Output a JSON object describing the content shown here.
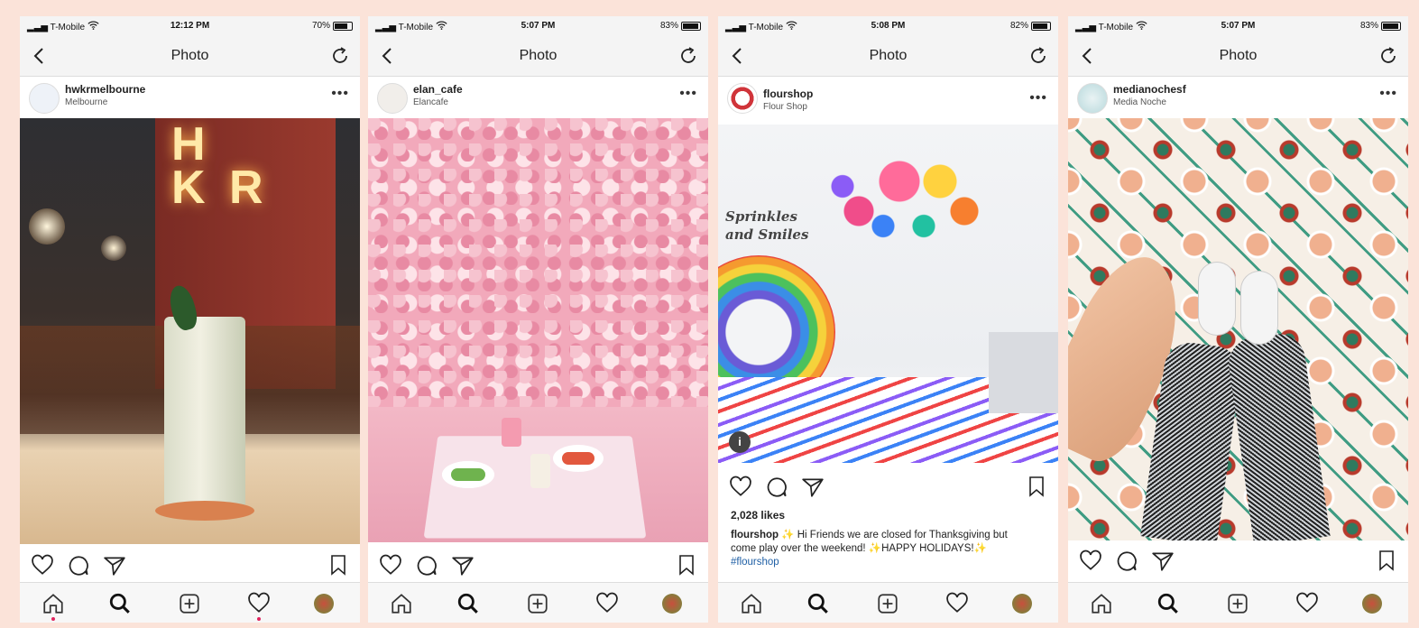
{
  "colors": {
    "background": "#fbe3d9",
    "hashtag": "#1f5fa5",
    "notification_dot": "#e0245e"
  },
  "phones": [
    {
      "status": {
        "carrier": "T-Mobile",
        "time": "12:12 PM",
        "battery": "70%",
        "battery_level": 0.7
      },
      "nav_title": "Photo",
      "post": {
        "username": "hwkrmelbourne",
        "location": "Melbourne",
        "photo_sign": "H\nK R"
      }
    },
    {
      "status": {
        "carrier": "T-Mobile",
        "time": "5:07 PM",
        "battery": "83%",
        "battery_level": 0.83
      },
      "nav_title": "Photo",
      "post": {
        "username": "elan_cafe",
        "location": "Elancafe"
      }
    },
    {
      "status": {
        "carrier": "T-Mobile",
        "time": "5:08 PM",
        "battery": "82%",
        "battery_level": 0.82
      },
      "nav_title": "Photo",
      "post": {
        "username": "flourshop",
        "location": "Flour Shop",
        "wall_text": "Sprinkles and Smiles",
        "likes": "2,028 likes",
        "caption_user": "flourshop",
        "caption_text": "✨ Hi Friends we are closed for Thanksgiving but come play over the weekend! ✨HAPPY HOLIDAYS!✨ ",
        "caption_hashtag": "#flourshop"
      }
    },
    {
      "status": {
        "carrier": "T-Mobile",
        "time": "5:07 PM",
        "battery": "83%",
        "battery_level": 0.83
      },
      "nav_title": "Photo",
      "post": {
        "username": "medianochesf",
        "location": "Media Noche"
      }
    }
  ],
  "icons": {
    "back": "chevron-left-icon",
    "refresh": "refresh-icon",
    "more": "more-dots-icon",
    "like": "heart-icon",
    "comment": "comment-icon",
    "share": "send-icon",
    "save": "bookmark-icon",
    "home": "home-icon",
    "search": "search-icon",
    "add": "add-post-icon",
    "activity": "heart-icon",
    "profile": "avatar"
  },
  "more_glyph": "•••"
}
